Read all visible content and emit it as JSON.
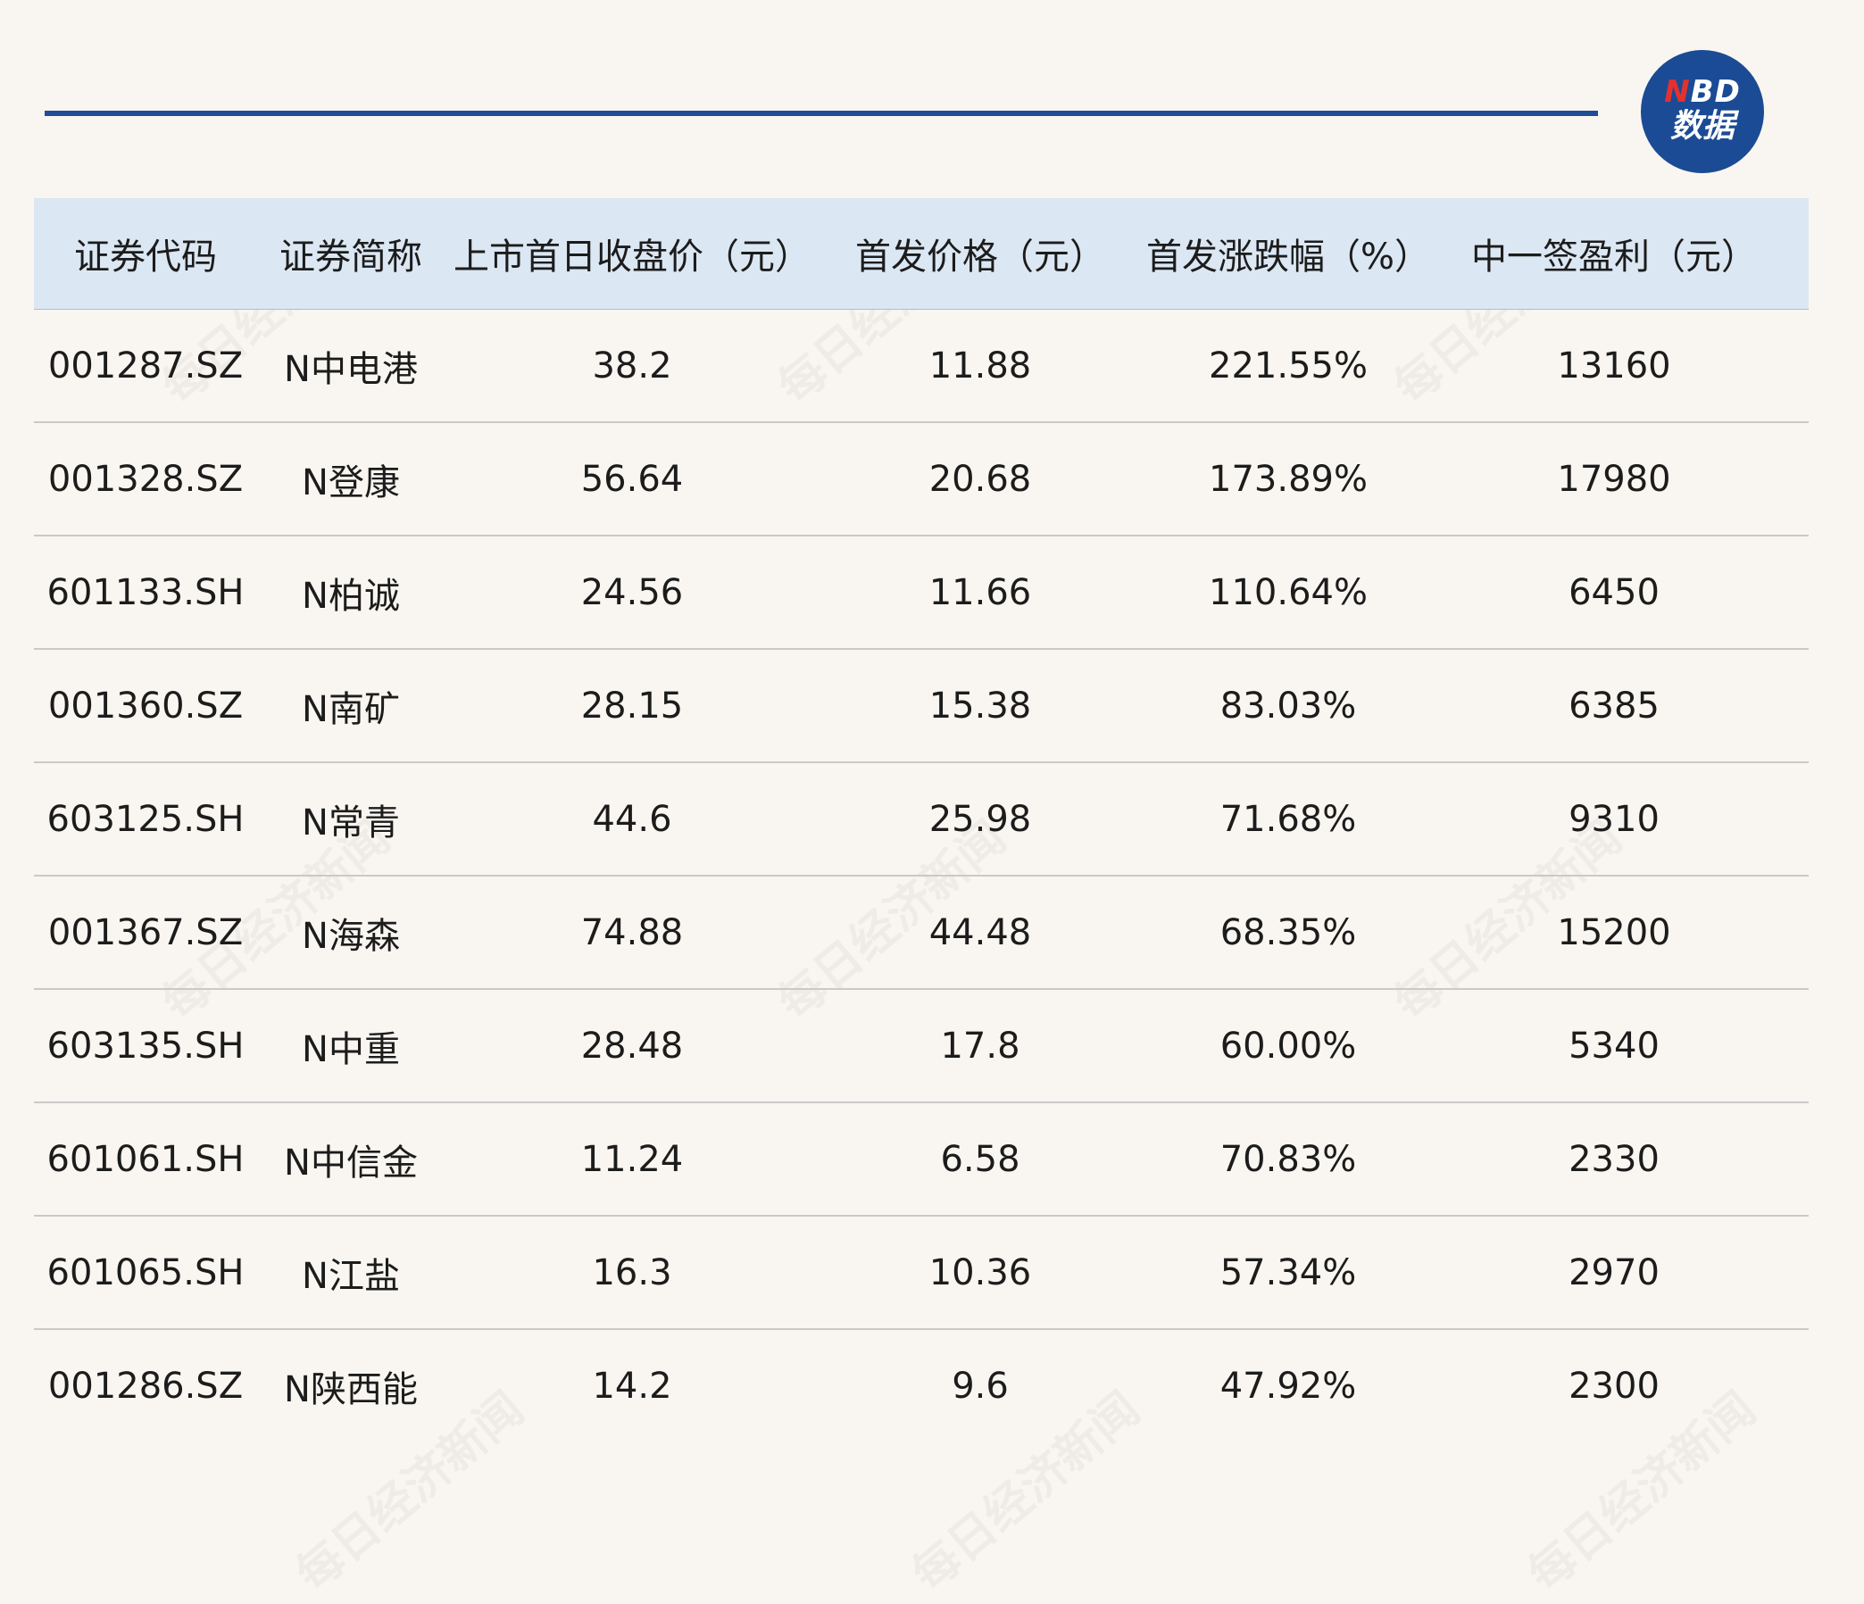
{
  "logo": {
    "brand_letter_red": "N",
    "brand_rest": "BD",
    "subtitle": "数据"
  },
  "watermark_text": "每日经济新闻",
  "table": {
    "headers": [
      "证券代码",
      "证券简称",
      "上市首日收盘价（元）",
      "首发价格（元）",
      "首发涨跌幅（%）",
      "中一签盈利（元）"
    ],
    "rows": [
      [
        "001287.SZ",
        "N中电港",
        "38.2",
        "11.88",
        "221.55%",
        "13160"
      ],
      [
        "001328.SZ",
        "N登康",
        "56.64",
        "20.68",
        "173.89%",
        "17980"
      ],
      [
        "601133.SH",
        "N柏诚",
        "24.56",
        "11.66",
        "110.64%",
        "6450"
      ],
      [
        "001360.SZ",
        "N南矿",
        "28.15",
        "15.38",
        "83.03%",
        "6385"
      ],
      [
        "603125.SH",
        "N常青",
        "44.6",
        "25.98",
        "71.68%",
        "9310"
      ],
      [
        "001367.SZ",
        "N海森",
        "74.88",
        "44.48",
        "68.35%",
        "15200"
      ],
      [
        "603135.SH",
        "N中重",
        "28.48",
        "17.8",
        "60.00%",
        "5340"
      ],
      [
        "601061.SH",
        "N中信金",
        "11.24",
        "6.58",
        "70.83%",
        "2330"
      ],
      [
        "601065.SH",
        "N江盐",
        "16.3",
        "10.36",
        "57.34%",
        "2970"
      ],
      [
        "001286.SZ",
        "N陕西能",
        "14.2",
        "9.6",
        "47.92%",
        "2300"
      ]
    ]
  },
  "colors": {
    "accent": "#1f4e96",
    "header_bg": "#dbe7f3",
    "page_bg": "#f9f6f1",
    "logo_red": "#e4312e"
  }
}
